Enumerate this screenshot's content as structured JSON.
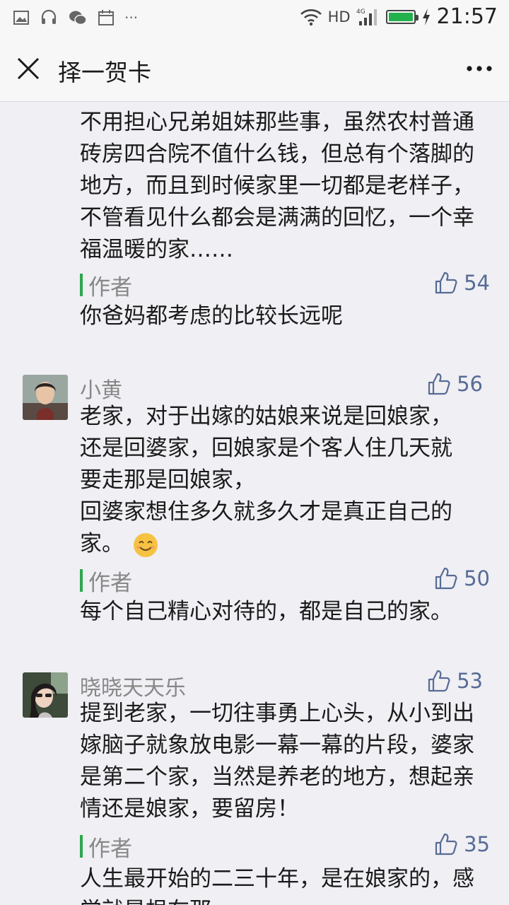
{
  "status_bar": {
    "network": "HD",
    "network_type": "4G",
    "time": "21:57"
  },
  "nav": {
    "title": "择一贺卡"
  },
  "comments": [
    {
      "text": "不用担心兄弟姐妹那些事，虽然农村普通砖房四合院不值什么钱，但总有个落脚的地方，而且到时候家里一切都是老样子，不管看见什么都会是满满的回忆，一个幸福温暖的家……",
      "author_label": "作者",
      "author_likes": "54",
      "author_reply": "你爸妈都考虑的比较长远呢"
    },
    {
      "name": "小黄",
      "likes": "56",
      "text_lines": [
        "老家，对于出嫁的姑娘来说是回娘家，",
        "还是回婆家，回娘家是个客人住几天就",
        "要走那是回娘家，",
        "回婆家想住多久就多久才是真正自己的",
        "家。"
      ],
      "author_label": "作者",
      "author_likes": "50",
      "author_reply": "每个自己精心对待的，都是自己的家。"
    },
    {
      "name": "晓晓天天乐",
      "likes": "53",
      "text": "提到老家，一切往事勇上心头，从小到出嫁脑子就象放电影一幕一幕的片段，婆家是第二个家，当然是养老的地方，想起亲情还是娘家，要留房！",
      "author_label": "作者",
      "author_likes": "35",
      "author_reply": "人生最开始的二三十年，是在娘家的，感觉就是根在那"
    }
  ],
  "colors": {
    "accent_green": "#2ca84c",
    "like_blue": "#576b95"
  },
  "icons": [
    "close-icon",
    "more-icon",
    "thumbs-up-icon",
    "wifi-icon",
    "signal-icon",
    "battery-icon",
    "smile-emoji"
  ]
}
